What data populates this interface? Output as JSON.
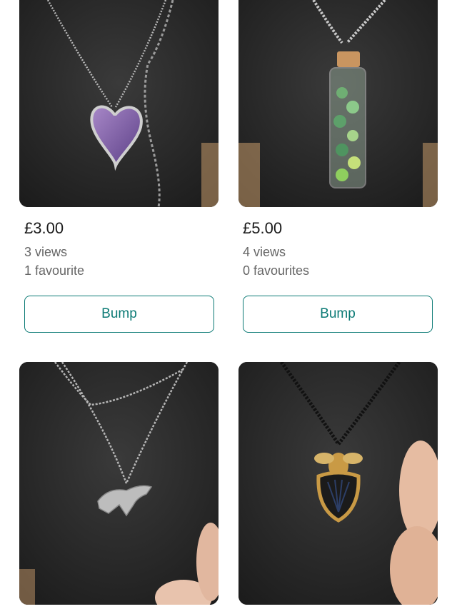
{
  "listings": [
    {
      "image": "purple heart pendant necklace",
      "price": "£3.00",
      "views": "3 views",
      "favourites": "1 favourite",
      "bump_label": "Bump"
    },
    {
      "image": "green bead bottle pendant necklace",
      "price": "£5.00",
      "views": "4 views",
      "favourites": "0 favourites",
      "bump_label": "Bump"
    },
    {
      "image": "silver horse pendant necklace"
    },
    {
      "image": "gold bee pendant necklace"
    }
  ],
  "colors": {
    "accent": "#0b7a75",
    "stat_text": "#666666",
    "price_text": "#1a1a1a"
  }
}
